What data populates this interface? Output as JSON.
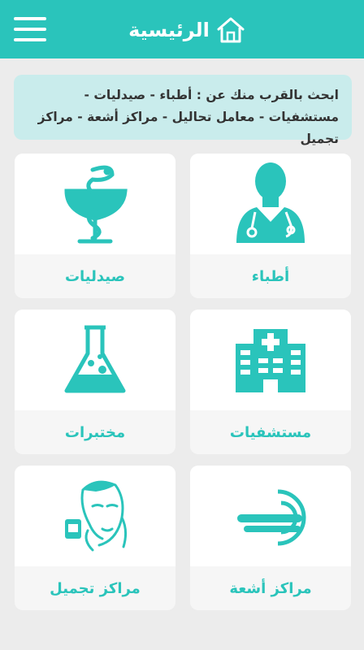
{
  "header": {
    "title": "الرئيسية",
    "home_icon": "home-icon",
    "menu_icon": "hamburger-menu-icon",
    "bar_color": "#2ac4bb"
  },
  "info": {
    "text": "ابحث بالقرب منك عن : أطباء - صيدليات - مستشفيات - معامل تحاليل - مراكز أشعة - مراكز تجميل",
    "background": "#c9ecec"
  },
  "categories": [
    {
      "label": "أطباء",
      "icon": "doctor-icon"
    },
    {
      "label": "صيدليات",
      "icon": "pharmacy-icon"
    },
    {
      "label": "مستشفيات",
      "icon": "hospital-icon"
    },
    {
      "label": "مختبرات",
      "icon": "lab-flask-icon"
    },
    {
      "label": "مراكز أشعة",
      "icon": "mri-scanner-icon"
    },
    {
      "label": "مراكز تجميل",
      "icon": "beauty-face-icon"
    }
  ],
  "accent_color": "#2ac4bb"
}
